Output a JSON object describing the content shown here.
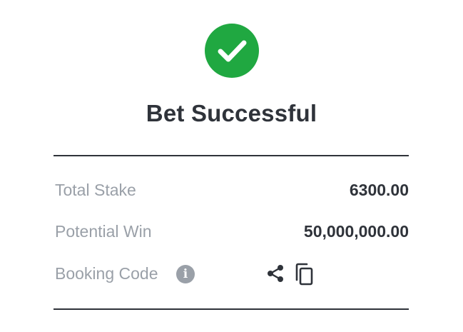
{
  "status": {
    "icon": "check-circle-icon",
    "title": "Bet Successful"
  },
  "details": {
    "total_stake": {
      "label": "Total Stake",
      "value": "6300.00"
    },
    "potential_win": {
      "label": "Potential Win",
      "value": "50,000,000.00"
    },
    "booking_code": {
      "label": "Booking Code",
      "value": "",
      "info_icon": "info-icon",
      "share_icon": "share-icon",
      "copy_icon": "copy-icon"
    }
  },
  "colors": {
    "success": "#20a841",
    "text_dark": "#2f333a",
    "text_muted": "#9aa0a8"
  }
}
